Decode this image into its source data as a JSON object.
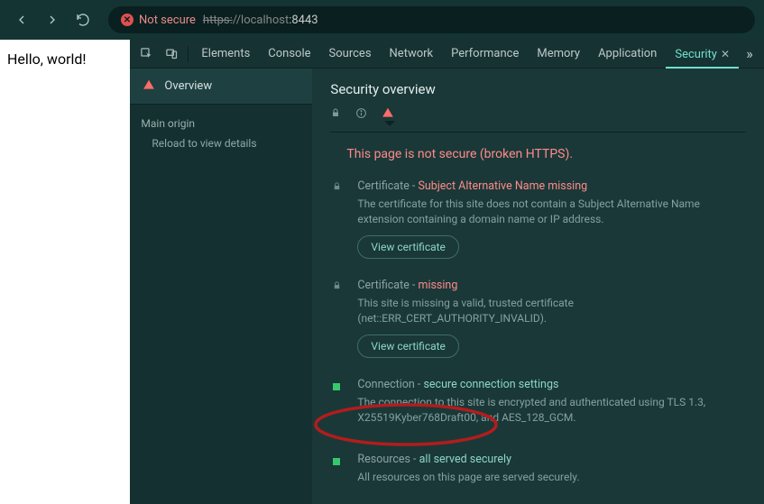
{
  "browser": {
    "not_secure_label": "Not secure",
    "url_scheme": "https:",
    "url_host": "//localhost",
    "url_port": ":8443"
  },
  "page": {
    "body_text": "Hello, world!"
  },
  "devtools": {
    "tabs": [
      "Elements",
      "Console",
      "Sources",
      "Network",
      "Performance",
      "Memory",
      "Application",
      "Security"
    ],
    "active_tab": "Security",
    "left": {
      "overview": "Overview",
      "main_origin": "Main origin",
      "reload_hint": "Reload to view details"
    },
    "security": {
      "title": "Security overview",
      "headline": "This page is not secure (broken HTTPS).",
      "items": [
        {
          "id": "cert-san",
          "icon": "lock",
          "label": "Certificate",
          "status_text": "Subject Alternative Name missing",
          "status_kind": "bad",
          "desc": "The certificate for this site does not contain a Subject Alternative Name extension containing a domain name or IP address.",
          "button": "View certificate"
        },
        {
          "id": "cert-missing",
          "icon": "lock",
          "label": "Certificate",
          "status_text": "missing",
          "status_kind": "bad",
          "desc": "This site is missing a valid, trusted certificate (net::ERR_CERT_AUTHORITY_INVALID).",
          "button": "View certificate"
        },
        {
          "id": "connection",
          "icon": "green",
          "label": "Connection",
          "status_text": "secure connection settings",
          "status_kind": "ok",
          "desc": "The connection to this site is encrypted and authenticated using TLS 1.3, X25519Kyber768Draft00, and AES_128_GCM.",
          "button": null
        },
        {
          "id": "resources",
          "icon": "green",
          "label": "Resources",
          "status_text": "all served securely",
          "status_kind": "ok",
          "desc": "All resources on this page are served securely.",
          "button": null
        }
      ]
    }
  }
}
